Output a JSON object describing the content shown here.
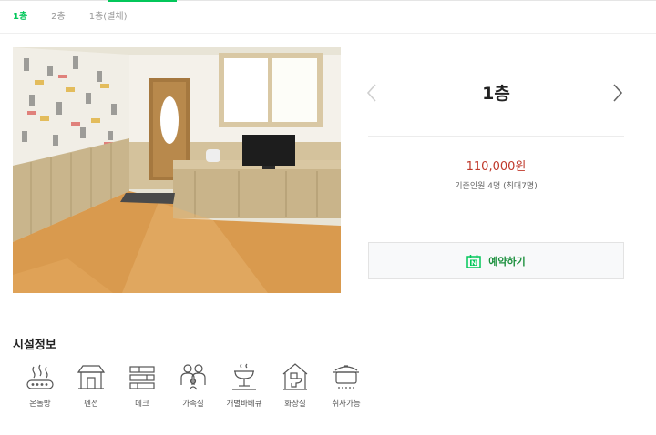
{
  "tabs": [
    {
      "label": "1층",
      "active": true
    },
    {
      "label": "2층",
      "active": false
    },
    {
      "label": "1층(별채)",
      "active": false
    }
  ],
  "room": {
    "title": "1층",
    "price": "110,000원",
    "capacity": "기준인원 4명 (최대7명)"
  },
  "reserve": {
    "label": "예약하기",
    "icon": "naver-calendar-icon",
    "accent": "#03c75a"
  },
  "facility_section": {
    "title": "시설정보",
    "items": [
      {
        "label": "온돌방",
        "icon": "ondol-floor-icon"
      },
      {
        "label": "펜션",
        "icon": "pension-house-icon"
      },
      {
        "label": "데크",
        "icon": "deck-icon"
      },
      {
        "label": "가족실",
        "icon": "family-room-icon"
      },
      {
        "label": "개별바베큐",
        "icon": "bbq-grill-icon"
      },
      {
        "label": "화장실",
        "icon": "toilet-icon"
      },
      {
        "label": "취사가능",
        "icon": "cooking-pot-icon"
      }
    ]
  },
  "colors": {
    "brand_green": "#03c75a",
    "price_red": "#c0392b"
  }
}
